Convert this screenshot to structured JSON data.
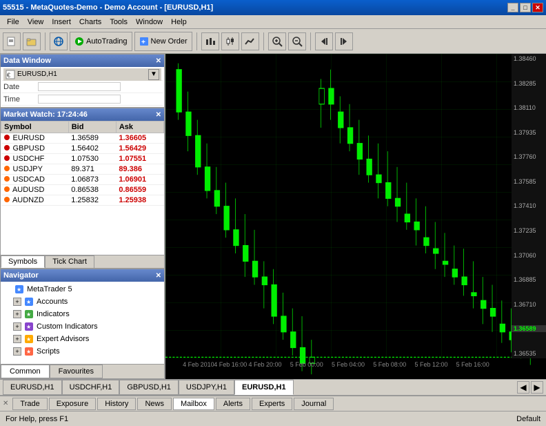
{
  "window": {
    "title": "55515 - MetaQuotes-Demo - Demo Account - [EURUSD,H1]",
    "minimize_label": "_",
    "maximize_label": "□",
    "close_label": "✕"
  },
  "menu": {
    "items": [
      "File",
      "View",
      "Insert",
      "Charts",
      "Tools",
      "Window",
      "Help"
    ]
  },
  "toolbar": {
    "autotrading_label": "AutoTrading",
    "new_order_label": "New Order"
  },
  "data_window": {
    "title": "Data Window",
    "symbol": "EURUSD,H1",
    "date_label": "Date",
    "time_label": "Time"
  },
  "market_watch": {
    "title": "Market Watch: 17:24:46",
    "col_symbol": "Symbol",
    "col_bid": "Bid",
    "col_ask": "Ask",
    "rows": [
      {
        "symbol": "EURUSD",
        "bid": "1.36589",
        "ask": "1.36605"
      },
      {
        "symbol": "GBPUSD",
        "bid": "1.56402",
        "ask": "1.56429"
      },
      {
        "symbol": "USDCHF",
        "bid": "1.07530",
        "ask": "1.07551"
      },
      {
        "symbol": "USDJPY",
        "bid": "89.371",
        "ask": "89.386"
      },
      {
        "symbol": "USDCAD",
        "bid": "1.06873",
        "ask": "1.06901"
      },
      {
        "symbol": "AUDUSD",
        "bid": "0.86538",
        "ask": "0.86559"
      },
      {
        "symbol": "AUDNZD",
        "bid": "1.25832",
        "ask": "1.25938"
      }
    ],
    "tabs": [
      "Symbols",
      "Tick Chart"
    ]
  },
  "navigator": {
    "title": "Navigator",
    "items": [
      {
        "label": "MetaTrader 5",
        "indent": 0,
        "has_expand": false
      },
      {
        "label": "Accounts",
        "indent": 1,
        "has_expand": true
      },
      {
        "label": "Indicators",
        "indent": 1,
        "has_expand": true
      },
      {
        "label": "Custom Indicators",
        "indent": 1,
        "has_expand": true
      },
      {
        "label": "Expert Advisors",
        "indent": 1,
        "has_expand": true
      },
      {
        "label": "Scripts",
        "indent": 1,
        "has_expand": true
      }
    ],
    "tabs": [
      "Common",
      "Favourites"
    ]
  },
  "chart": {
    "symbol": "EURUSD,H1",
    "price_labels": [
      "1.38460",
      "1.38285",
      "1.38110",
      "1.37935",
      "1.37760",
      "1.37585",
      "1.37410",
      "1.37235",
      "1.37060",
      "1.36885",
      "1.36710",
      "1.36589",
      "1.36535"
    ],
    "current_price": "1.36589",
    "time_labels": [
      {
        "label": "4 Feb 2010",
        "pos": "5%"
      },
      {
        "label": "4 Feb 16:00",
        "pos": "14%"
      },
      {
        "label": "4 Feb 20:00",
        "pos": "24%"
      },
      {
        "label": "5 Feb 00:00",
        "pos": "36%"
      },
      {
        "label": "5 Feb 04:00",
        "pos": "48%"
      },
      {
        "label": "5 Feb 08:00",
        "pos": "60%"
      },
      {
        "label": "5 Feb 12:00",
        "pos": "72%"
      },
      {
        "label": "5 Feb 16:00",
        "pos": "84%"
      }
    ]
  },
  "chart_tabs": [
    {
      "label": "EURUSD,H1",
      "active": false
    },
    {
      "label": "USDCHF,H1",
      "active": false
    },
    {
      "label": "GBPUSD,H1",
      "active": false
    },
    {
      "label": "USDJPY,H1",
      "active": false
    },
    {
      "label": "EURUSD,H1",
      "active": true
    }
  ],
  "status_tabs": [
    {
      "label": "Trade",
      "active": false
    },
    {
      "label": "Exposure",
      "active": false
    },
    {
      "label": "History",
      "active": false
    },
    {
      "label": "News",
      "active": false
    },
    {
      "label": "Mailbox",
      "active": true
    },
    {
      "label": "Alerts",
      "active": false
    },
    {
      "label": "Experts",
      "active": false
    },
    {
      "label": "Journal",
      "active": false
    }
  ],
  "status_bar": {
    "help_text": "For Help, press F1",
    "mode_text": "Default"
  }
}
